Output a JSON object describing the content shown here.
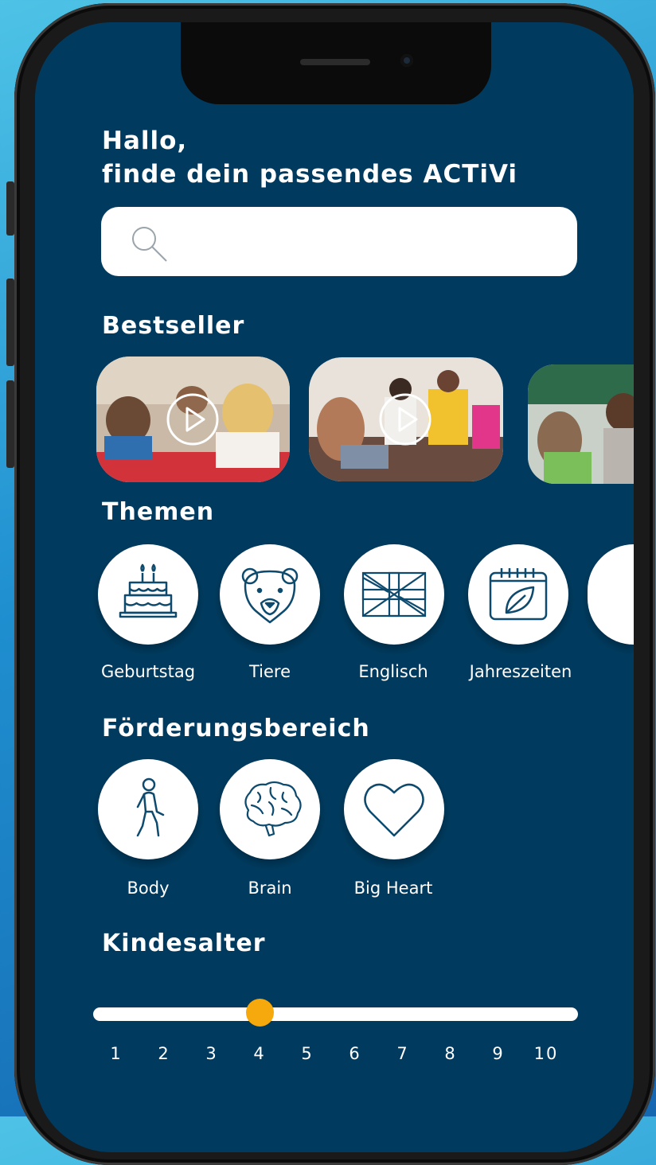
{
  "header": {
    "greeting_line1": "Hallo,",
    "greeting_line2": "finde dein passendes ACTiVi"
  },
  "search": {
    "placeholder": "",
    "icon": "search-icon"
  },
  "bestseller": {
    "title": "Bestseller",
    "cards": [
      {
        "name": "bestseller-video-1",
        "has_play": true
      },
      {
        "name": "bestseller-video-2",
        "has_play": true
      },
      {
        "name": "bestseller-video-3",
        "has_play": false
      }
    ]
  },
  "themen": {
    "title": "Themen",
    "items": [
      {
        "label": "Geburtstag",
        "icon": "birthday-cake-icon"
      },
      {
        "label": "Tiere",
        "icon": "bear-icon"
      },
      {
        "label": "Englisch",
        "icon": "union-jack-flag-icon"
      },
      {
        "label": "Jahreszeiten",
        "icon": "calendar-leaf-icon"
      },
      {
        "label": "",
        "icon": "more-topic-icon"
      }
    ]
  },
  "foerderung": {
    "title": "Förderungsbereich",
    "items": [
      {
        "label": "Body",
        "icon": "walking-person-icon"
      },
      {
        "label": "Brain",
        "icon": "brain-icon"
      },
      {
        "label": "Big Heart",
        "icon": "heart-icon"
      }
    ]
  },
  "kindesalter": {
    "title": "Kindesalter",
    "ticks": [
      "1",
      "2",
      "3",
      "4",
      "5",
      "6",
      "7",
      "8",
      "9",
      "10"
    ],
    "selected": 4
  },
  "colors": {
    "screen_bg": "#003b5f",
    "accent": "#f6a90c",
    "icon_stroke": "#0d4a6e"
  }
}
